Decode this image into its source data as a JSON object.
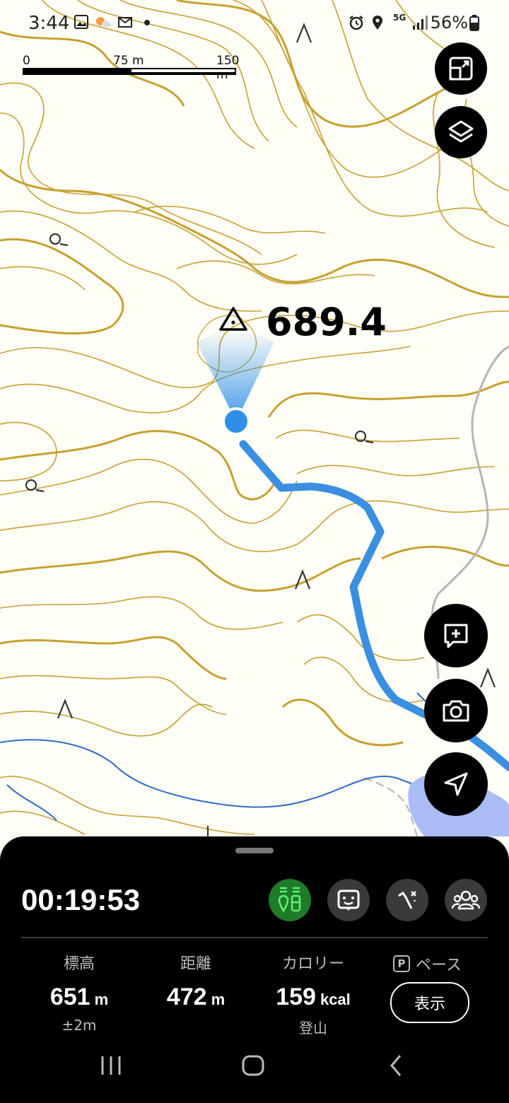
{
  "status_bar": {
    "time": "3:44",
    "network": "5G",
    "battery": "56%",
    "icons": [
      "image-icon",
      "cloud-icon",
      "mail-icon",
      "dot-icon",
      "alarm-icon",
      "location-icon",
      "signal-icon",
      "battery-icon"
    ]
  },
  "map": {
    "scale_bar": {
      "labels": [
        "0",
        "75 m",
        "150 m"
      ]
    },
    "peak": {
      "label": "689.4",
      "icon": "triangulation-point-icon"
    },
    "colors": {
      "contour": "#c7a02f",
      "track": "#3a8fe0",
      "road": "#b5b5b5",
      "stream": "#2e6cc9",
      "water": "#a9bcf5",
      "position": "#2f8fe6"
    }
  },
  "map_buttons": [
    "fullscreen-icon",
    "layers-icon",
    "add-note-icon",
    "camera-icon",
    "navigate-icon"
  ],
  "tracking": {
    "elapsed_time": "00:19:53",
    "tools": [
      "track-mode-icon",
      "face-icon",
      "route-icon",
      "group-icon"
    ],
    "stats": [
      {
        "label": "標高",
        "value": "651",
        "unit": "m",
        "sub": "±2m"
      },
      {
        "label": "距離",
        "value": "472",
        "unit": "m",
        "sub": ""
      },
      {
        "label": "カロリー",
        "value": "159",
        "unit": "kcal",
        "sub": "登山"
      }
    ],
    "pace": {
      "badge": "P",
      "label": "ペース",
      "button": "表示"
    }
  },
  "nav_bar": [
    "recent-apps-icon",
    "home-icon",
    "back-icon"
  ]
}
